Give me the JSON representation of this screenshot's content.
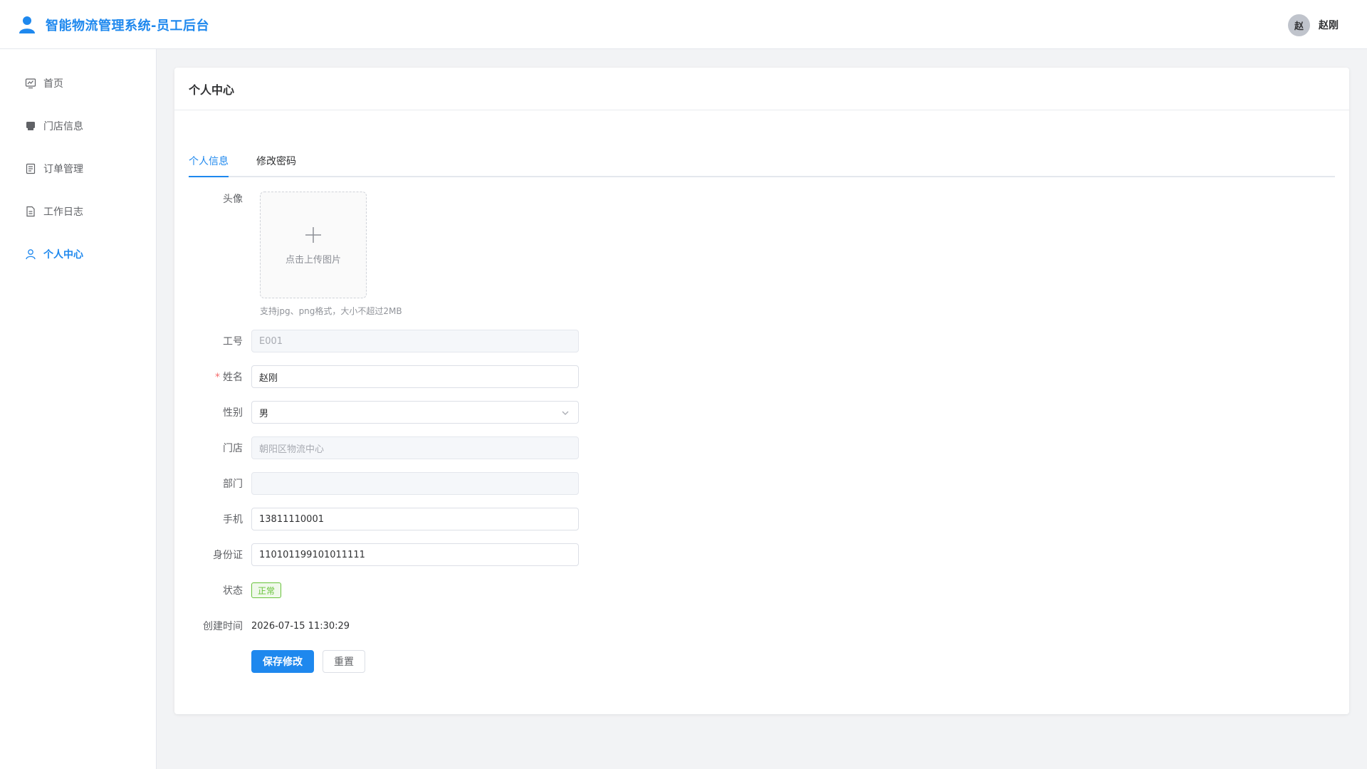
{
  "header": {
    "title": "智能物流管理系统-员工后台",
    "user_avatar_text": "赵",
    "user_name": "赵刚"
  },
  "colors": {
    "accent": "#1e88ee",
    "success": "#67c23a",
    "required": "#f56c6c"
  },
  "sidebar": {
    "items": [
      {
        "label": "首页",
        "icon": "chart-icon"
      },
      {
        "label": "门店信息",
        "icon": "store-icon"
      },
      {
        "label": "订单管理",
        "icon": "document-list-icon"
      },
      {
        "label": "工作日志",
        "icon": "document-icon"
      },
      {
        "label": "个人中心",
        "icon": "user-icon",
        "active": true
      }
    ]
  },
  "page": {
    "title": "个人中心",
    "tabs": [
      {
        "label": "个人信息",
        "active": true
      },
      {
        "label": "修改密码",
        "active": false
      }
    ]
  },
  "form": {
    "avatar_label": "头像",
    "upload_text": "点击上传图片",
    "upload_tip": "支持jpg、png格式，大小不超过2MB",
    "employee_id_label": "工号",
    "employee_id": "E001",
    "name_label": "姓名",
    "name_required_mark": "*",
    "name": "赵刚",
    "gender_label": "性别",
    "gender": "男",
    "store_label": "门店",
    "store": "朝阳区物流中心",
    "department_label": "部门",
    "department": "",
    "phone_label": "手机",
    "phone": "13811110001",
    "id_card_label": "身份证",
    "id_card": "110101199101011111",
    "status_label": "状态",
    "status": "正常",
    "created_label": "创建时间",
    "created_at": "2026-07-15 11:30:29"
  },
  "buttons": {
    "save": "保存修改",
    "reset": "重置"
  }
}
